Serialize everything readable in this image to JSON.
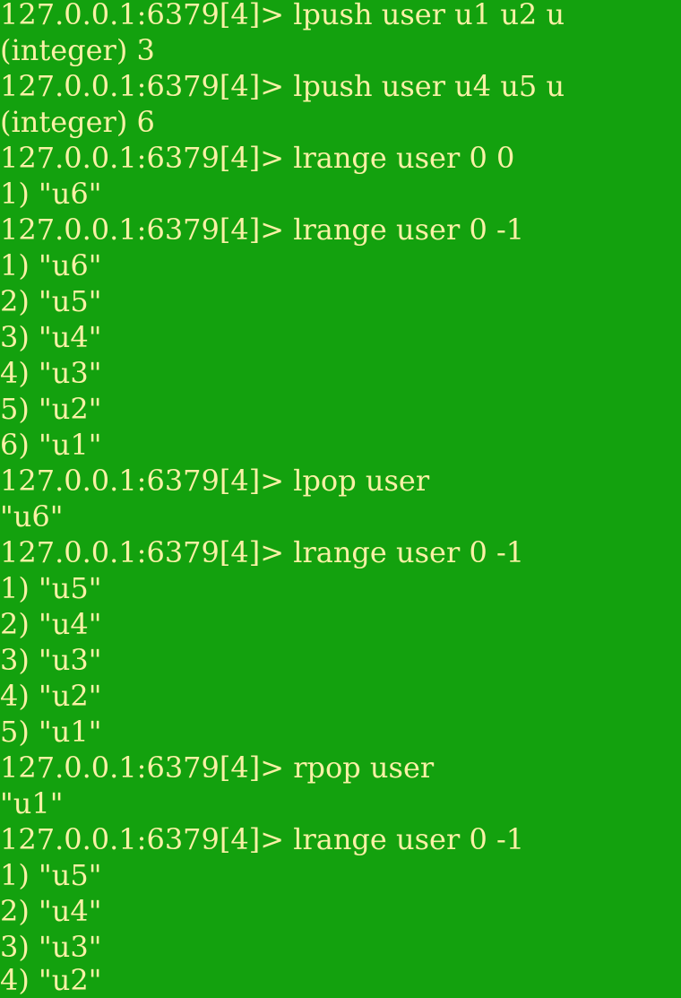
{
  "terminal": {
    "lines": [
      "127.0.0.1:6379[4]> lpush user u1 u2 u",
      "(integer) 3",
      "127.0.0.1:6379[4]> lpush user u4 u5 u",
      "(integer) 6",
      "127.0.0.1:6379[4]> lrange user 0 0",
      "1) \"u6\"",
      "127.0.0.1:6379[4]> lrange user 0 -1",
      "1) \"u6\"",
      "2) \"u5\"",
      "3) \"u4\"",
      "4) \"u3\"",
      "5) \"u2\"",
      "6) \"u1\"",
      "127.0.0.1:6379[4]> lpop user",
      "\"u6\"",
      "127.0.0.1:6379[4]> lrange user 0 -1",
      "1) \"u5\"",
      "2) \"u4\"",
      "3) \"u3\"",
      "4) \"u2\"",
      "5) \"u1\"",
      "127.0.0.1:6379[4]> rpop user",
      "\"u1\"",
      "127.0.0.1:6379[4]> lrange user 0 -1",
      "1) \"u5\"",
      "2) \"u4\"",
      "3) \"u3\"",
      "4) \"u2\""
    ]
  }
}
